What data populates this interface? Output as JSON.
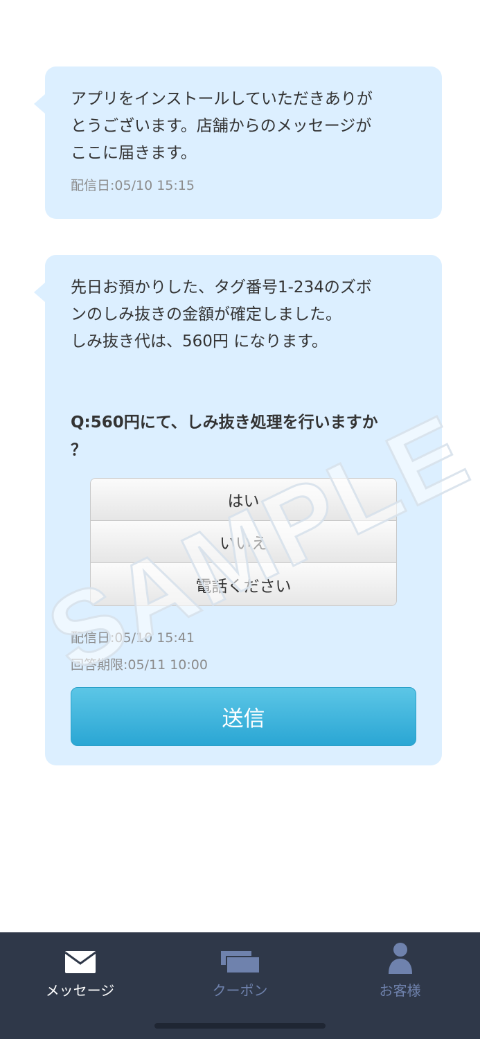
{
  "messages": [
    {
      "text": "アプリをインストールしていただきありが\nとうございます。店舗からのメッセージが\nここに届きます。",
      "delivered": "配信日:05/10 15:15"
    },
    {
      "text": "先日お預かりした、タグ番号1-234のズボ\nンのしみ抜きの金額が確定しました。\nしみ抜き代は、560円 になります。",
      "question": "Q:560円にて、しみ抜き処理を行いますか\n？",
      "options": [
        "はい",
        "いいえ",
        "電話ください"
      ],
      "delivered": "配信日:05/10 15:41",
      "deadline": "回答期限:05/11 10:00",
      "send_label": "送信"
    }
  ],
  "watermark": "SAMPLE",
  "tabs": [
    {
      "label": "メッセージ",
      "icon": "envelope-icon",
      "active": true
    },
    {
      "label": "クーポン",
      "icon": "coupon-icon",
      "active": false
    },
    {
      "label": "お客様",
      "icon": "person-icon",
      "active": false
    }
  ],
  "colors": {
    "bubble": "#dcefff",
    "send_button": "#3bb3dc",
    "tabbar": "#2f3849",
    "tab_active": "#ffffff",
    "tab_inactive": "#6f82ad"
  }
}
